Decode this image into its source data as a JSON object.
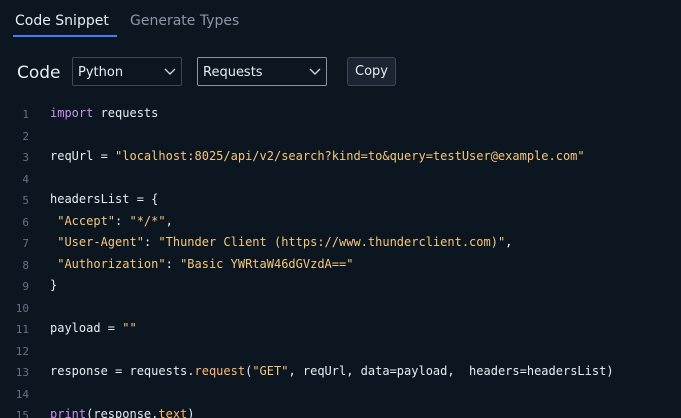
{
  "tabs": {
    "code_snippet": "Code Snippet",
    "generate_types": "Generate Types"
  },
  "toolbar": {
    "label": "Code",
    "language": "Python",
    "library": "Requests",
    "copy": "Copy"
  },
  "code": {
    "lines": [
      {
        "n": "1",
        "segments": [
          [
            "kw",
            "import"
          ],
          [
            "",
            " requests"
          ]
        ]
      },
      {
        "n": "2",
        "segments": []
      },
      {
        "n": "3",
        "segments": [
          [
            "",
            "reqUrl = "
          ],
          [
            "str",
            "\"localhost:8025/api/v2/search?kind=to&query=testUser@example.com\""
          ]
        ]
      },
      {
        "n": "4",
        "segments": []
      },
      {
        "n": "5",
        "segments": [
          [
            "",
            "headersList = {"
          ]
        ]
      },
      {
        "n": "6",
        "segments": [
          [
            "",
            " "
          ],
          [
            "str",
            "\"Accept\""
          ],
          [
            "",
            ": "
          ],
          [
            "str",
            "\"*/*\""
          ],
          [
            "",
            ","
          ]
        ]
      },
      {
        "n": "7",
        "segments": [
          [
            "",
            " "
          ],
          [
            "str",
            "\"User-Agent\""
          ],
          [
            "",
            ": "
          ],
          [
            "str",
            "\"Thunder Client (https://www.thunderclient.com)\""
          ],
          [
            "",
            ","
          ]
        ]
      },
      {
        "n": "8",
        "segments": [
          [
            "",
            " "
          ],
          [
            "str",
            "\"Authorization\""
          ],
          [
            "",
            ": "
          ],
          [
            "str",
            "\"Basic YWRtaW46dGVzdA==\""
          ]
        ]
      },
      {
        "n": "9",
        "segments": [
          [
            "",
            "}"
          ]
        ]
      },
      {
        "n": "10",
        "segments": []
      },
      {
        "n": "11",
        "segments": [
          [
            "",
            "payload = "
          ],
          [
            "str",
            "\"\""
          ]
        ]
      },
      {
        "n": "12",
        "segments": []
      },
      {
        "n": "13",
        "segments": [
          [
            "",
            "response = requests."
          ],
          [
            "fn",
            "request"
          ],
          [
            "",
            "("
          ],
          [
            "str",
            "\"GET\""
          ],
          [
            "",
            ", reqUrl, data=payload,  headers=headersList)"
          ]
        ]
      },
      {
        "n": "14",
        "segments": []
      },
      {
        "n": "15",
        "segments": [
          [
            "kw",
            "print"
          ],
          [
            "",
            "(response."
          ],
          [
            "fn",
            "text"
          ],
          [
            "",
            ")"
          ]
        ]
      }
    ]
  },
  "icons": {
    "language_select": "chevron-down-icon",
    "library_select": "chevron-down-icon"
  },
  "colors": {
    "background": "#0c1621",
    "accent": "#3b82f6",
    "keyword": "#c792ea",
    "string": "#f5c77e",
    "function": "#ffb86c"
  }
}
